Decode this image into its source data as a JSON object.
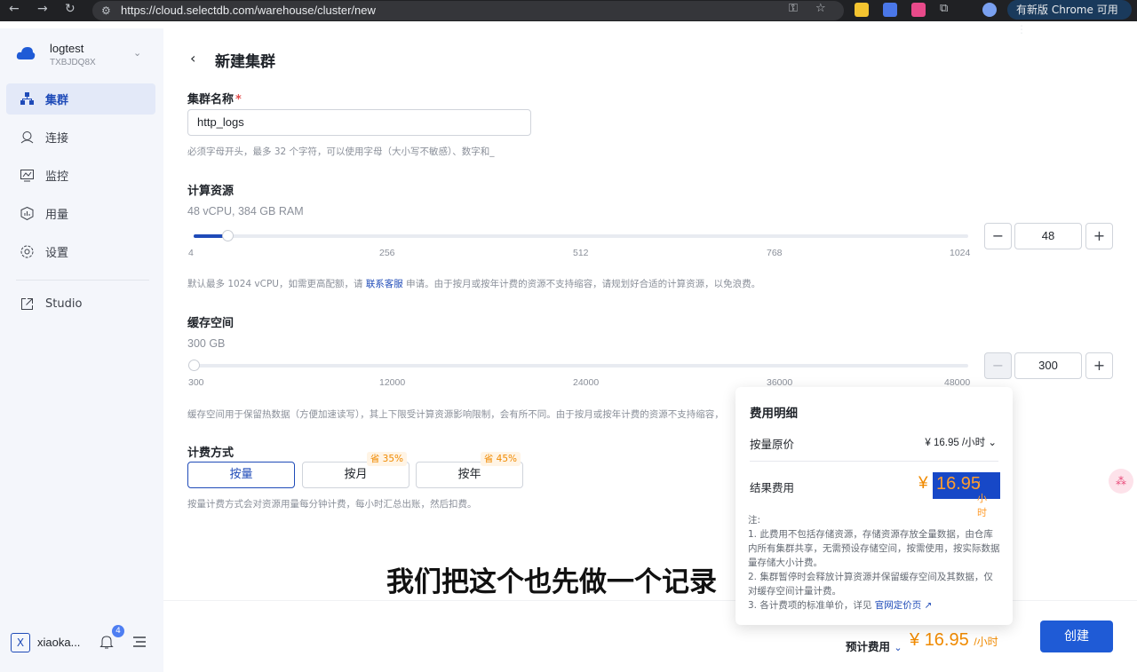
{
  "browser": {
    "url": "https://cloud.selectdb.com/warehouse/cluster/new",
    "update_label": "有新版 Chrome 可用"
  },
  "sidebar": {
    "workspace_name": "logtest",
    "workspace_id": "TXBJDQ8X",
    "items": [
      {
        "label": "集群",
        "icon": "cluster-icon",
        "active": true
      },
      {
        "label": "连接",
        "icon": "connect-icon"
      },
      {
        "label": "监控",
        "icon": "monitor-icon"
      },
      {
        "label": "用量",
        "icon": "usage-icon"
      },
      {
        "label": "设置",
        "icon": "settings-icon"
      },
      {
        "label": "Studio",
        "icon": "external-link-icon"
      }
    ],
    "user_initial": "X",
    "user_name": "xiaoka...",
    "notification_count": "4"
  },
  "page": {
    "title": "新建集群",
    "cluster_name": {
      "label": "集群名称",
      "required_mark": "*",
      "value": "http_logs",
      "hint": "必须字母开头，最多 32 个字符，可以使用字母（大小写不敏感）、数字和_"
    },
    "compute": {
      "label": "计算资源",
      "summary": "48 vCPU, 384 GB RAM",
      "ticks": [
        "4",
        "256",
        "512",
        "768",
        "1024"
      ],
      "value": "48",
      "min": 4,
      "max": 1024,
      "hint_prefix": "默认最多 1024 vCPU，如需更高配额，请",
      "hint_link": "联系客服",
      "hint_suffix": "申请。由于按月或按年计费的资源不支持缩容，请规划好合适的计算资源，以免浪费。"
    },
    "cache": {
      "label": "缓存空间",
      "summary": "300 GB",
      "ticks": [
        "300",
        "12000",
        "24000",
        "36000",
        "48000"
      ],
      "value": "300",
      "min": 300,
      "max": 48000,
      "hint": "缓存空间用于保留热数据（方便加速读写），其上下限受计算资源影响限制，会有所不同。由于按月或按年计费的资源不支持缩容，"
    },
    "billing": {
      "label": "计费方式",
      "options": [
        {
          "label": "按量",
          "active": true,
          "badge": ""
        },
        {
          "label": "按月",
          "active": false,
          "badge": "省 35%"
        },
        {
          "label": "按年",
          "active": false,
          "badge": "省 45%"
        }
      ],
      "hint": "按量计费方式会对资源用量每分钟计费，每小时汇总出账，然后扣费。"
    }
  },
  "cost_popover": {
    "title": "费用明细",
    "base_label": "按量原价",
    "base_value": "¥ 16.95 /小时",
    "total_label": "结果费用",
    "total_currency": "¥",
    "total_value": "16.95",
    "total_unit": "/小时",
    "notes_title": "注:",
    "note1": "1. 此费用不包括存储资源，存储资源存放全量数据，由仓库内所有集群共享，无需预设存储空间，按需使用，按实际数据量存储大小计费。",
    "note2": "2. 集群暂停时会释放计算资源并保留缓存空间及其数据，仅对缓存空间计量计费。",
    "note3_prefix": "3. 各计费项的标准单价，详见",
    "note3_link": "官网定价页"
  },
  "footer": {
    "estimate_label": "预计费用",
    "estimate_currency": "¥",
    "estimate_value": "16.95",
    "estimate_unit": "/小时",
    "create_label": "创建"
  },
  "subtitle": "我们把这个也先做一个记录",
  "colors": {
    "primary": "#1f4bb8",
    "price": "#f08a00",
    "sidebar_bg": "#f4f6fb"
  }
}
